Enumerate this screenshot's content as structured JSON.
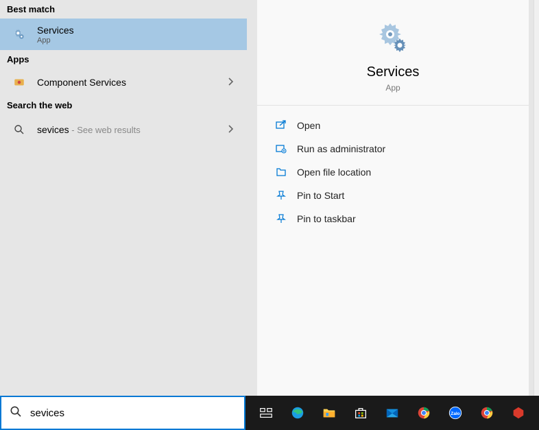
{
  "left": {
    "bestMatchHeader": "Best match",
    "bestMatch": {
      "title": "Services",
      "sub": "App"
    },
    "appsHeader": "Apps",
    "apps": [
      {
        "title": "Component Services"
      }
    ],
    "webHeader": "Search the web",
    "web": {
      "term": "sevices",
      "suffix": " - See web results"
    }
  },
  "hero": {
    "title": "Services",
    "sub": "App"
  },
  "actions": {
    "open": "Open",
    "runAdmin": "Run as administrator",
    "openLoc": "Open file location",
    "pinStart": "Pin to Start",
    "pinTaskbar": "Pin to taskbar"
  },
  "search": {
    "value": "sevices"
  }
}
